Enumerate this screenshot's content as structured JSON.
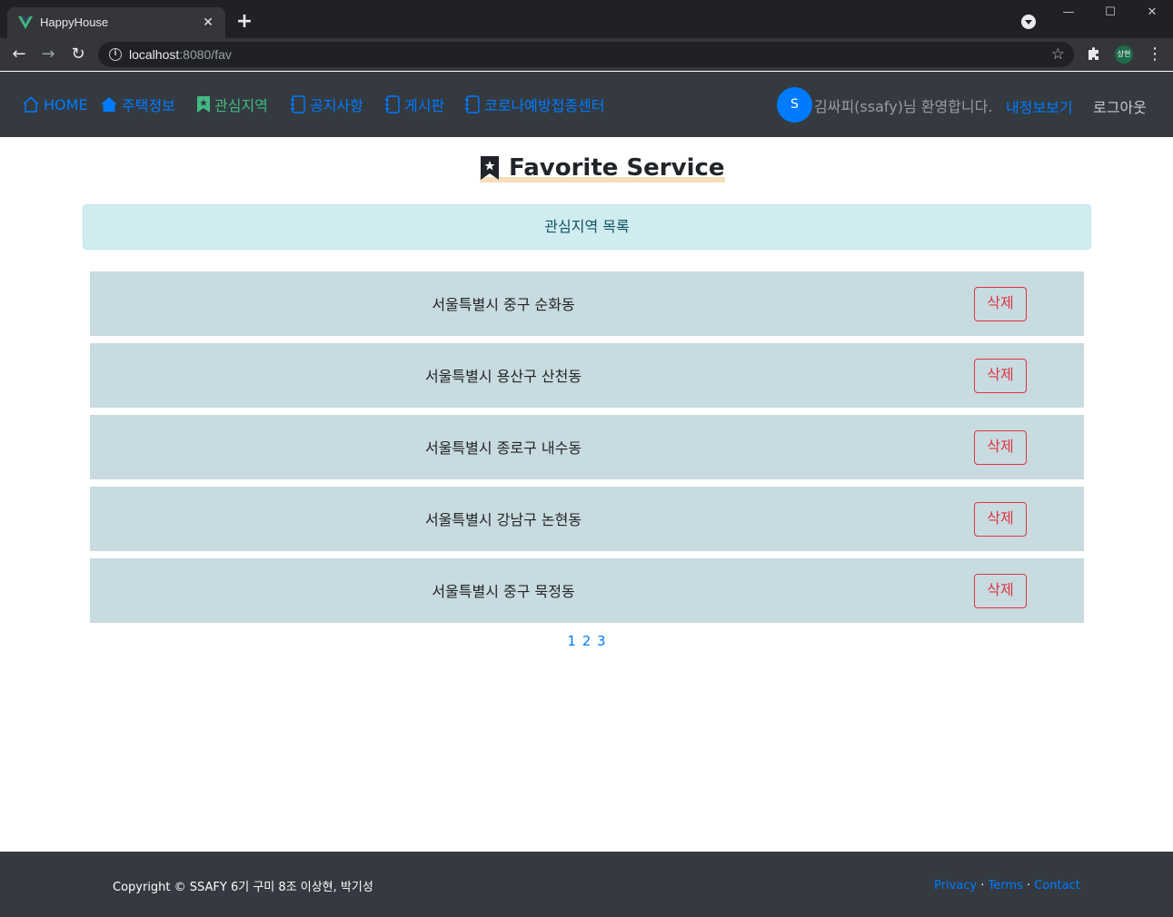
{
  "browser": {
    "tab_title": "HappyHouse",
    "url_host": "localhost",
    "url_path": ":8080/fav",
    "profile_initials": "상현"
  },
  "nav": {
    "items": [
      {
        "label": "HOME",
        "icon": "house-outline-icon"
      },
      {
        "label": "주택정보",
        "icon": "house-fill-icon"
      },
      {
        "label": "관심지역",
        "icon": "bookmark-star-icon"
      },
      {
        "label": "공지사항",
        "icon": "journal-icon"
      },
      {
        "label": "게시판",
        "icon": "journal-icon"
      },
      {
        "label": "코로나예방접종센터",
        "icon": "journal-icon"
      }
    ],
    "avatar_initial": "S",
    "welcome_text": "김싸피(ssafy)님 환영합니다.",
    "mypage_label": "내정보보기",
    "logout_label": "로그아웃"
  },
  "main": {
    "title": "Favorite Service",
    "alert_text": "관심지역 목록",
    "favorites": [
      {
        "region": "서울특별시 중구 순화동",
        "delete_label": "삭제"
      },
      {
        "region": "서울특별시 용산구 산천동",
        "delete_label": "삭제"
      },
      {
        "region": "서울특별시 종로구 내수동",
        "delete_label": "삭제"
      },
      {
        "region": "서울특별시 강남구 논현동",
        "delete_label": "삭제"
      },
      {
        "region": "서울특별시 중구 묵정동",
        "delete_label": "삭제"
      }
    ],
    "pages": [
      "1",
      "2",
      "3"
    ]
  },
  "footer": {
    "copyright": "Copyright © SSAFY 6기 구미 8조 이상현, 박기성",
    "links": [
      "Privacy",
      "Terms",
      "Contact"
    ],
    "separator": "·"
  },
  "colors": {
    "nav_bg": "#343a40",
    "link_blue": "#007bff",
    "active_green": "#42b983",
    "row_bg": "#c8dbe0",
    "danger": "#dc3545",
    "alert_bg": "#d1ecf1"
  }
}
